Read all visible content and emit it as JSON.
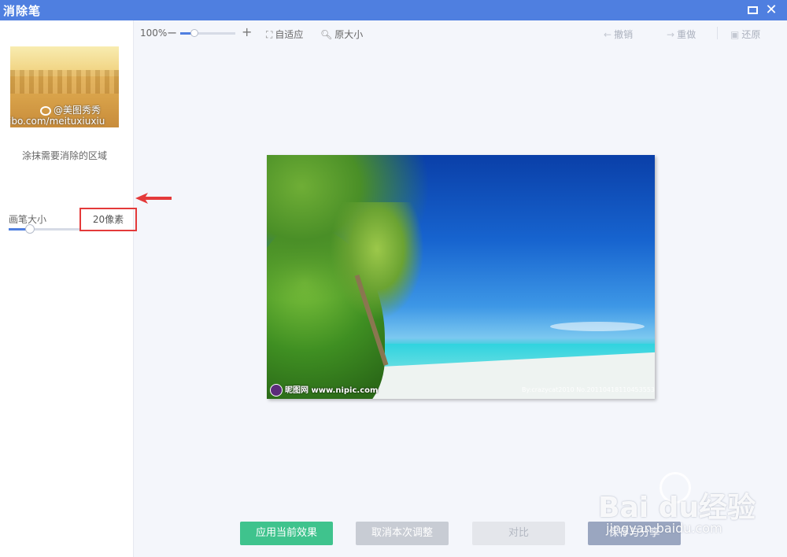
{
  "window": {
    "title": "消除笔"
  },
  "toolbar": {
    "zoom_level": "100%",
    "zoom_fraction": 0.25,
    "fit_label": "自适应",
    "original_size_label": "原大小",
    "undo_label": "撤销",
    "redo_label": "重做",
    "restore_label": "还原"
  },
  "sidebar": {
    "preview_watermark_top": "@美图秀秀",
    "preview_watermark_bottom": "ibo.com/meituxiuxiu",
    "hint": "涂抹需要消除的区域",
    "brush_size_label": "画笔大小",
    "brush_size_value": "20像素",
    "brush_size_fraction": 0.3
  },
  "canvas": {
    "watermark_left": "昵图网 www.nipic.com",
    "watermark_right": "By:crazycat2010 No.20110418110453553000"
  },
  "actions": {
    "apply_label": "应用当前效果",
    "cancel_label": "取消本次调整",
    "compare_label": "对比",
    "save_share_label": "保存与分享"
  },
  "watermark": {
    "brand": "Bai du经验",
    "url": "jingyan.baidu.com"
  },
  "colors": {
    "titlebar": "#4f7fe0",
    "apply": "#3fc38d",
    "highlight_box": "#e43a3a"
  }
}
